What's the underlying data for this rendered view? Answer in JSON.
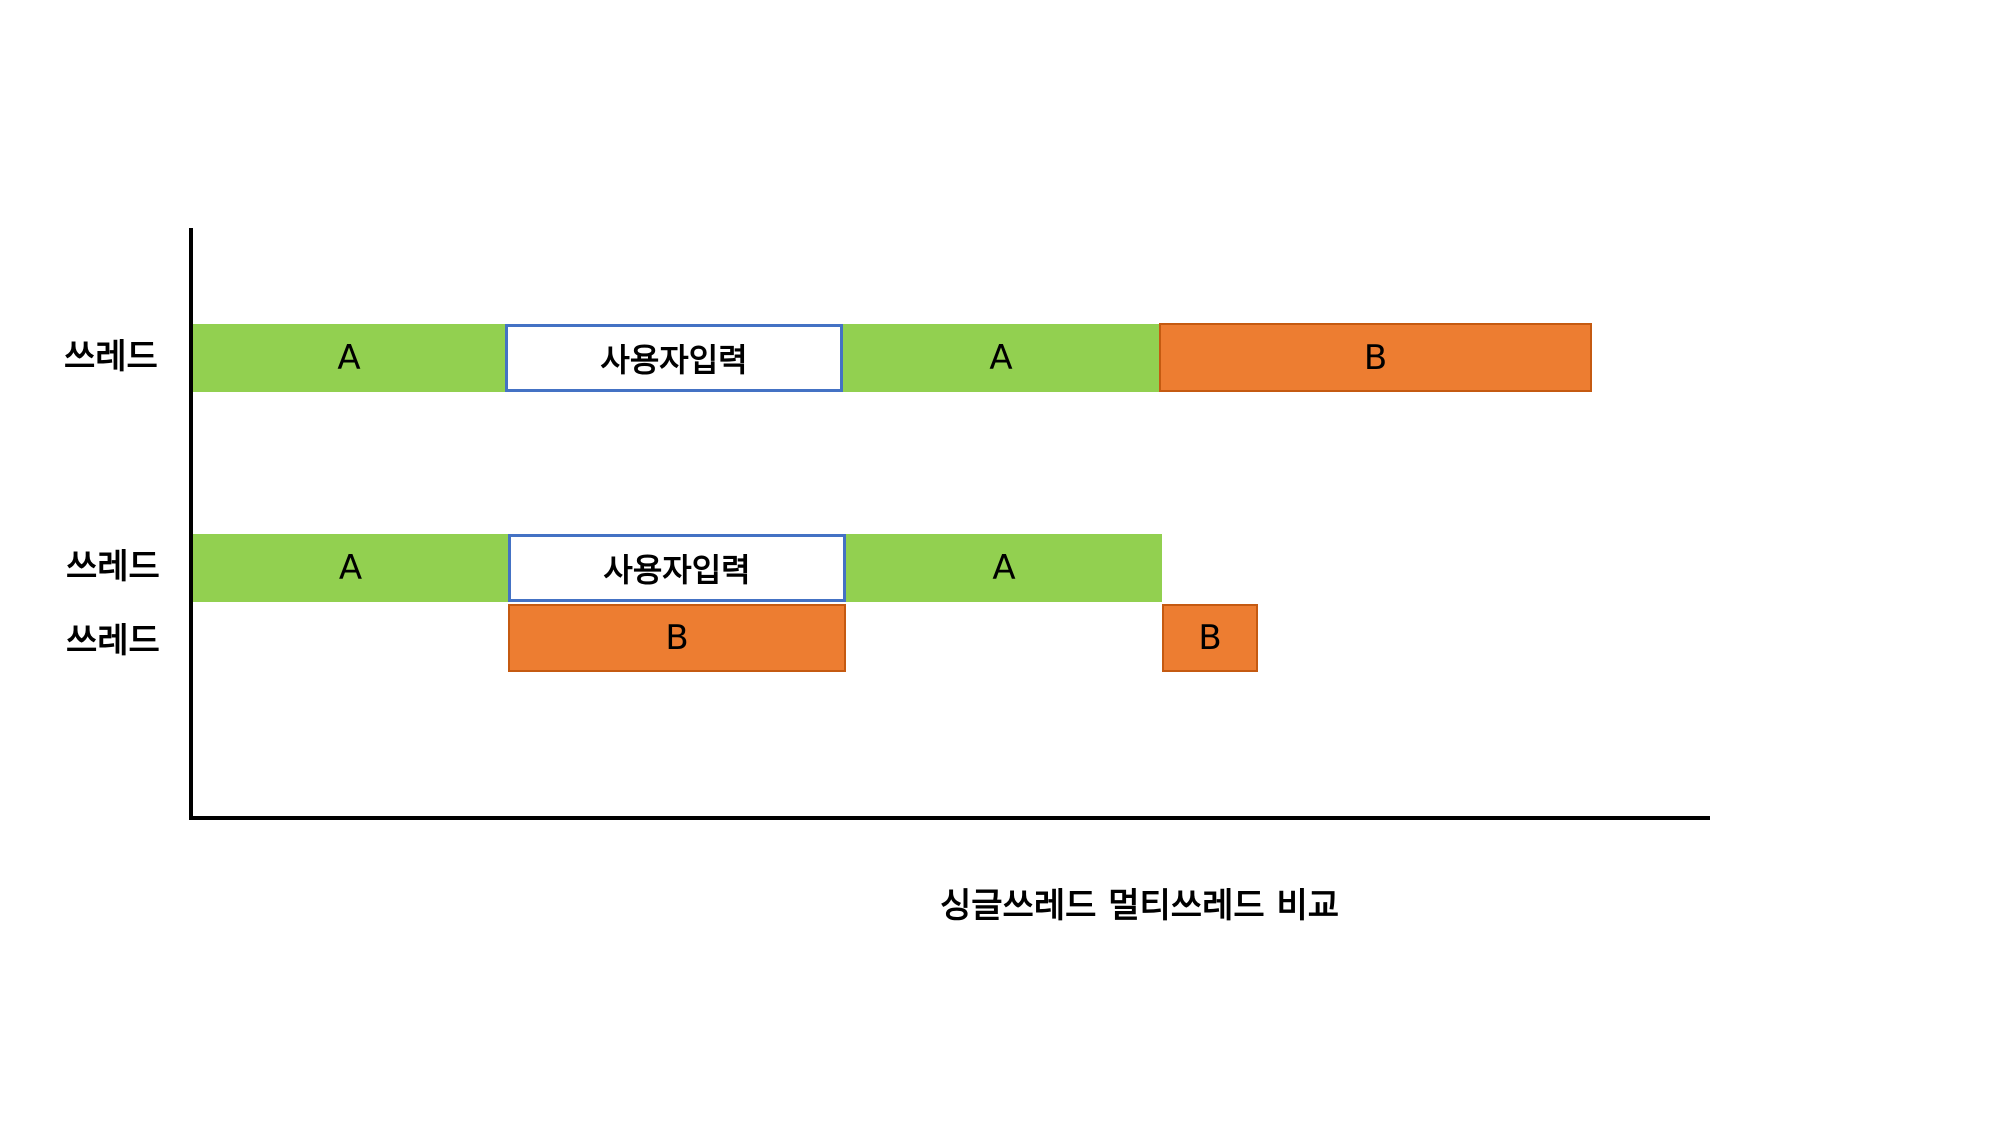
{
  "rows": {
    "single": {
      "label": "쓰레드",
      "blocks": [
        "A",
        "사용자입력",
        "A",
        "B"
      ]
    },
    "multi_1": {
      "label": "쓰레드",
      "blocks": [
        "A",
        "사용자입력",
        "A"
      ]
    },
    "multi_2": {
      "label": "쓰레드",
      "blocks": [
        "B",
        "B"
      ]
    }
  },
  "caption": "싱글쓰레드 멀티쓰레드 비교",
  "colors": {
    "task_a": "#92d050",
    "task_b": "#ed7d31",
    "user_input_border": "#4472c4",
    "axis": "#000000"
  }
}
